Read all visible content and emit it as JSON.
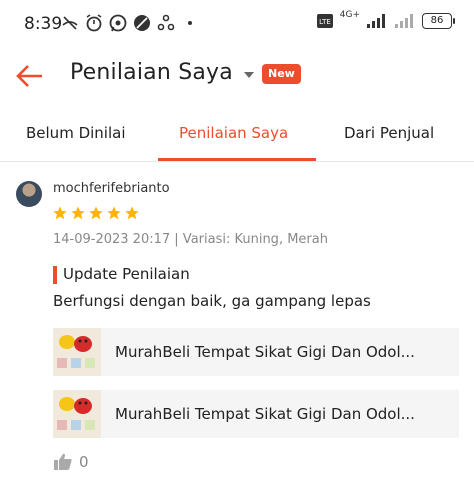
{
  "status_bar": {
    "time": "8:39",
    "icons": [
      "missed-call-icon",
      "alarm-icon",
      "whatsapp-icon",
      "app-icon",
      "share-icon",
      "dot-icon"
    ],
    "network": "4G+",
    "battery": "86"
  },
  "header": {
    "title": "Penilaian Saya",
    "badge": "New",
    "accent_color": "#ee4d2d"
  },
  "tabs": [
    {
      "label": "Belum Dinilai",
      "active": false
    },
    {
      "label": "Penilaian Saya",
      "active": true
    },
    {
      "label": "Dari Penjual",
      "active": false
    }
  ],
  "review": {
    "username": "mochferifebrianto",
    "rating": 5,
    "date": "14-09-2023 20:17",
    "variant": "| Variasi: Kuning, Merah",
    "update_label": "Update Penilaian",
    "text": "Berfungsi dengan baik, ga gampang lepas",
    "products": [
      {
        "name": "MurahBeli Tempat Sikat Gigi Dan Odol..."
      },
      {
        "name": "MurahBeli Tempat Sikat Gigi Dan Odol..."
      }
    ],
    "likes": "0"
  }
}
